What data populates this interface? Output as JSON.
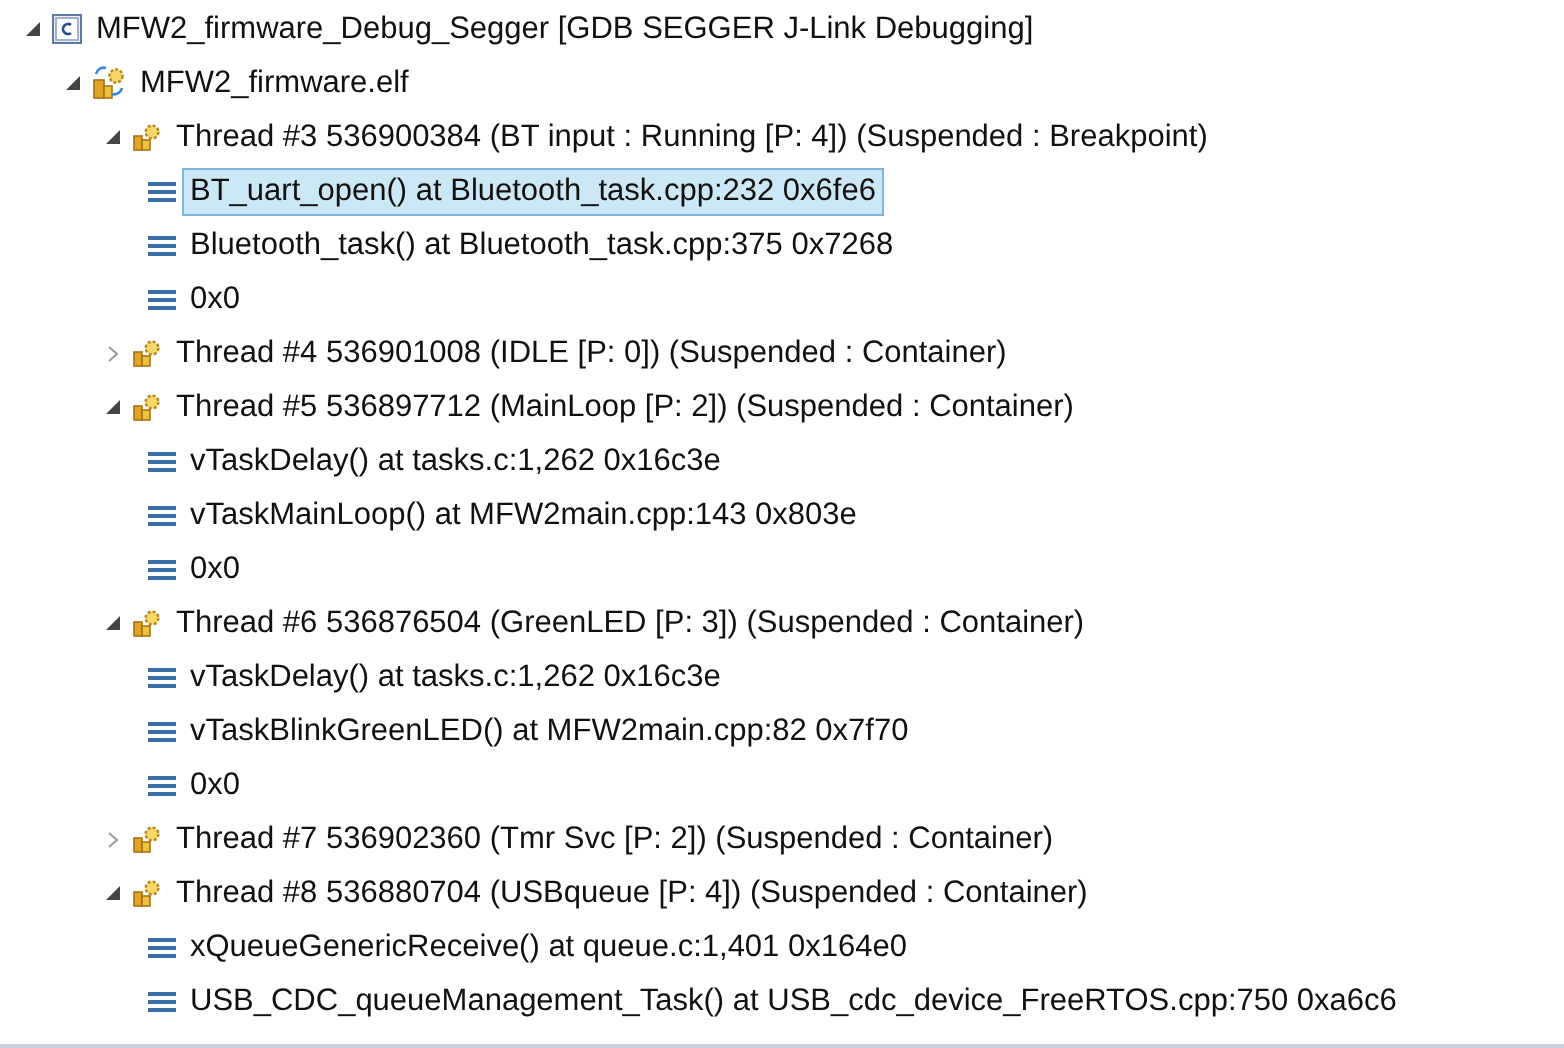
{
  "tree": [
    {
      "kind": "project",
      "label": "MFW2_firmware_Debug_Segger [GDB SEGGER J-Link Debugging]",
      "expanded": true,
      "selected": false,
      "children": [
        {
          "kind": "process",
          "label": "MFW2_firmware.elf",
          "expanded": true,
          "selected": false,
          "children": [
            {
              "kind": "thread",
              "label": "Thread #3 536900384 (BT input : Running [P: 4]) (Suspended : Breakpoint)",
              "expanded": true,
              "selected": false,
              "children": [
                {
                  "kind": "frame",
                  "label": "BT_uart_open() at Bluetooth_task.cpp:232 0x6fe6",
                  "selected": true
                },
                {
                  "kind": "frame",
                  "label": "Bluetooth_task() at Bluetooth_task.cpp:375 0x7268",
                  "selected": false
                },
                {
                  "kind": "frame",
                  "label": "0x0",
                  "selected": false
                }
              ]
            },
            {
              "kind": "thread",
              "label": "Thread #4 536901008 (IDLE [P: 0]) (Suspended : Container)",
              "expanded": false,
              "selected": false
            },
            {
              "kind": "thread",
              "label": "Thread #5 536897712 (MainLoop [P: 2]) (Suspended : Container)",
              "expanded": true,
              "selected": false,
              "children": [
                {
                  "kind": "frame",
                  "label": "vTaskDelay() at tasks.c:1,262 0x16c3e",
                  "selected": false
                },
                {
                  "kind": "frame",
                  "label": "vTaskMainLoop() at MFW2main.cpp:143 0x803e",
                  "selected": false
                },
                {
                  "kind": "frame",
                  "label": "0x0",
                  "selected": false
                }
              ]
            },
            {
              "kind": "thread",
              "label": "Thread #6 536876504 (GreenLED [P: 3]) (Suspended : Container)",
              "expanded": true,
              "selected": false,
              "children": [
                {
                  "kind": "frame",
                  "label": "vTaskDelay() at tasks.c:1,262 0x16c3e",
                  "selected": false
                },
                {
                  "kind": "frame",
                  "label": "vTaskBlinkGreenLED() at MFW2main.cpp:82 0x7f70",
                  "selected": false
                },
                {
                  "kind": "frame",
                  "label": "0x0",
                  "selected": false
                }
              ]
            },
            {
              "kind": "thread",
              "label": "Thread #7 536902360 (Tmr Svc [P: 2]) (Suspended : Container)",
              "expanded": false,
              "selected": false
            },
            {
              "kind": "thread",
              "label": "Thread #8 536880704 (USBqueue [P: 4]) (Suspended : Container)",
              "expanded": true,
              "selected": false,
              "children": [
                {
                  "kind": "frame",
                  "label": "xQueueGenericReceive() at queue.c:1,401 0x164e0",
                  "selected": false
                },
                {
                  "kind": "frame",
                  "label": "USB_CDC_queueManagement_Task() at USB_cdc_device_FreeRTOS.cpp:750 0xa6c6",
                  "selected": false
                }
              ]
            }
          ]
        }
      ]
    }
  ]
}
